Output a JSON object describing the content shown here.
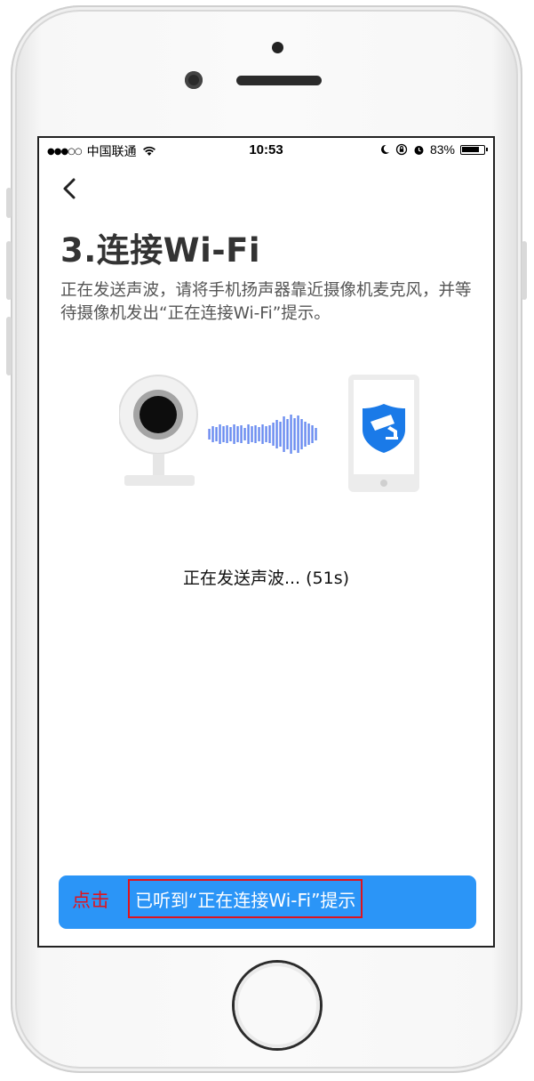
{
  "status_bar": {
    "signal": "●●●○○",
    "carrier": "中国联通",
    "time": "10:53",
    "battery_percent": "83%",
    "battery_level": 0.83
  },
  "header": {
    "back_icon": "chevron-left-icon"
  },
  "page": {
    "title": "3.连接Wi-Fi",
    "description": "正在发送声波，请将手机扬声器靠近摄像机麦克风，并等待摄像机发出“正在连接Wi-Fi”提示。",
    "progress_text": "正在发送声波... (51s)"
  },
  "action": {
    "click_hint": "点击",
    "confirm_label": "已听到“正在连接Wi-Fi”提示"
  },
  "colors": {
    "accent": "#2b95f7",
    "highlight_red": "#e0131c",
    "title_text": "#333333",
    "body_text": "#555555"
  }
}
